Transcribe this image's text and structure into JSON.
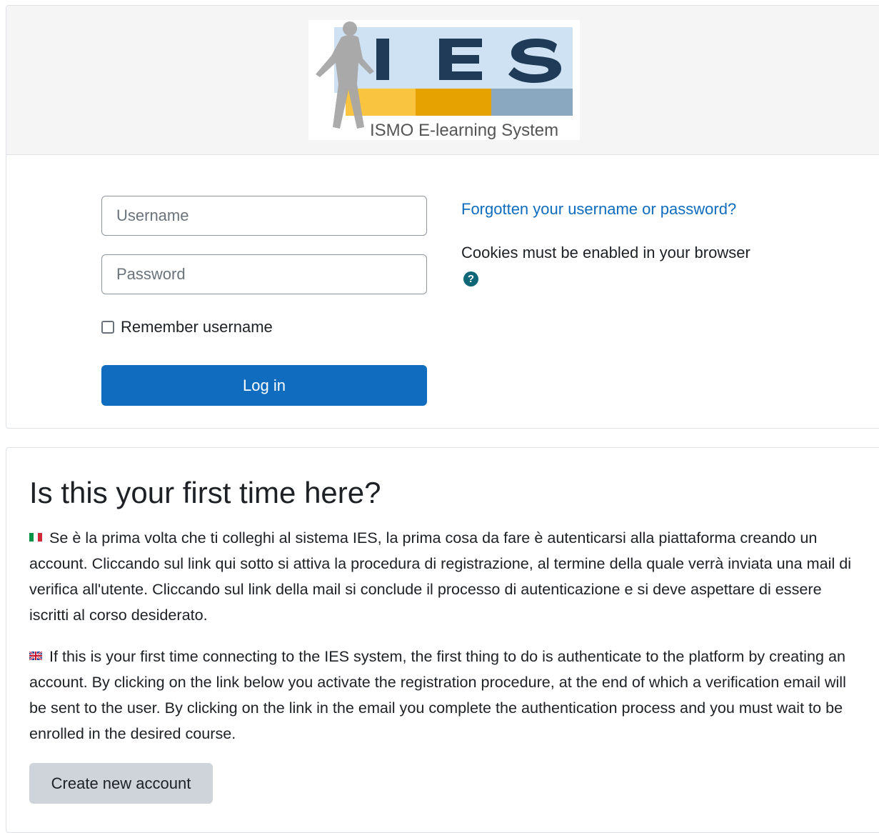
{
  "logo": {
    "letters": "I E S",
    "tagline": "ISMO E-learning System"
  },
  "login": {
    "username_placeholder": "Username",
    "password_placeholder": "Password",
    "remember_label": "Remember username",
    "remember_checked": false,
    "login_button": "Log in",
    "forgot_link": "Forgotten your username or password?",
    "cookies_notice": "Cookies must be enabled in your browser",
    "help_icon": "question-circle-icon"
  },
  "first_time": {
    "title": "Is this your first time here?",
    "paragraph_it": "Se è la prima volta che ti colleghi al sistema IES, la prima cosa da fare è autenticarsi alla piattaforma creando un account. Cliccando sul link qui sotto si attiva la procedura di registrazione, al termine della quale verrà inviata una mail di verifica all'utente. Cliccando sul link della mail si conclude il processo di autenticazione e si deve aspettare di essere iscritti al corso desiderato.",
    "paragraph_en": "If this is your first time connecting to the IES system, the first thing to do is authenticate to the platform by creating an account. By clicking on the link below you activate the registration procedure, at the end of which a verification email will be sent to the user. By clicking on the link in the email you complete the authentication process and you must wait to be enrolled in the desired course.",
    "create_account_button": "Create new account"
  },
  "colors": {
    "primary": "#0f6cbf",
    "secondary_button": "#ced4da",
    "text": "#1d2125",
    "help_icon": "#0f6677"
  }
}
